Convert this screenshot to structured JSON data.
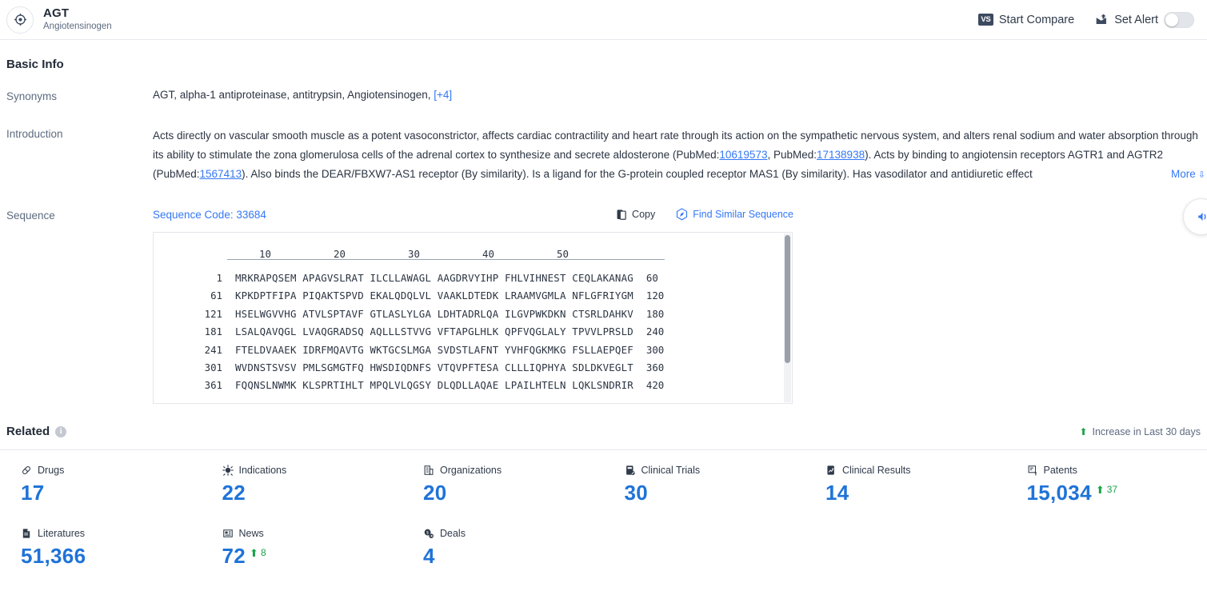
{
  "header": {
    "logo_icon": "target-crosshair-icon",
    "title": "AGT",
    "subtitle": "Angiotensinogen",
    "compare_badge": "VS",
    "compare_label": "Start Compare",
    "alert_icon": "alert-envelope-icon",
    "alert_label": "Set Alert",
    "alert_toggle_state": "off"
  },
  "basic_info": {
    "section_title": "Basic Info",
    "synonyms": {
      "label": "Synonyms",
      "value": "AGT,  alpha-1 antiproteinase, antitrypsin,  Angiotensinogen,",
      "more_count": "[+4]"
    },
    "introduction": {
      "label": "Introduction",
      "part1": "Acts directly on vascular smooth muscle as a potent vasoconstrictor, affects cardiac contractility and heart rate through its action on the sympathetic nervous system, and alters renal sodium and water absorption through its ability to stimulate the zona glomerulosa cells of the adrenal cortex to synthesize and secrete aldosterone (PubMed:",
      "pubmed1": "10619573",
      "part2": ", PubMed:",
      "pubmed2": "17138938",
      "part3": "). Acts by binding to angiotensin receptors AGTR1 and AGTR2 (PubMed:",
      "pubmed3": "1567413",
      "part4": "). Also binds the DEAR/FBXW7-AS1 receptor (By similarity). Is a ligand for the G-protein coupled receptor MAS1 (By similarity). Has vasodilator and antidiuretic effect",
      "more_label": "More",
      "more_chevron": "chevron-double-down-icon"
    },
    "sequence": {
      "label": "Sequence",
      "code_label": "Sequence Code: 33684",
      "copy_icon": "copy-icon",
      "copy_label": "Copy",
      "find_similar_icon": "hexagon-compass-icon",
      "find_similar_label": "Find Similar Sequence",
      "ruler_ticks": [
        "10",
        "20",
        "30",
        "40",
        "50"
      ],
      "lines": [
        {
          "start": "1",
          "chunks": "MRKRAPQSEM APAGVSLRAT ILCLLAWAGL AAGDRVYIHP FHLVIHNEST CEQLAKANAG",
          "end": "60"
        },
        {
          "start": "61",
          "chunks": "KPKDPTFIPA PIQAKTSPVD EKALQDQLVL VAAKLDTEDK LRAAMVGMLA NFLGFRIYGM",
          "end": "120"
        },
        {
          "start": "121",
          "chunks": "HSELWGVVHG ATVLSPTAVF GTLASLYLGA LDHTADRLQA ILGVPWKDKN CTSRLDAHKV",
          "end": "180"
        },
        {
          "start": "181",
          "chunks": "LSALQAVQGL LVAQGRADSQ AQLLLSTVVG VFTAPGLHLK QPFVQGLALY TPVVLPRSLD",
          "end": "240"
        },
        {
          "start": "241",
          "chunks": "FTELDVAAEK IDRFMQAVTG WKTGCSLMGA SVDSTLAFNT YVHFQGKMKG FSLLAEPQEF",
          "end": "300"
        },
        {
          "start": "301",
          "chunks": "WVDNSTSVSV PMLSGMGTFQ HWSDIQDNFS VTQVPFTESA CLLLIQPHYA SDLDKVEGLT",
          "end": "360"
        },
        {
          "start": "361",
          "chunks": "FQQNSLNWMK KLSPRTIHLT MPQLVLQGSY DLQDLLAQAE LPAILHTELN LQKLSNDRIR",
          "end": "420"
        }
      ]
    }
  },
  "related": {
    "title": "Related",
    "info_icon": "info-icon",
    "info_glyph": "i",
    "increase_arrow": "arrow-up-icon",
    "increase_label": "Increase in Last 30 days",
    "cards": [
      {
        "icon": "pill-icon",
        "label": "Drugs",
        "value": "17"
      },
      {
        "icon": "virus-icon",
        "label": "Indications",
        "value": "22"
      },
      {
        "icon": "building-icon",
        "label": "Organizations",
        "value": "20"
      },
      {
        "icon": "clinical-trial-icon",
        "label": "Clinical Trials",
        "value": "30"
      },
      {
        "icon": "clinical-result-icon",
        "label": "Clinical Results",
        "value": "14"
      },
      {
        "icon": "patent-icon",
        "label": "Patents",
        "value": "15,034",
        "delta": "37"
      },
      {
        "icon": "literature-icon",
        "label": "Literatures",
        "value": "51,366"
      },
      {
        "icon": "news-icon",
        "label": "News",
        "value": "72",
        "delta": "8"
      },
      {
        "icon": "deals-icon",
        "label": "Deals",
        "value": "4"
      }
    ]
  },
  "colors": {
    "accent_blue": "#3478f6",
    "value_blue": "#1f73d8",
    "green": "#1aa34a",
    "dark_navy": "#3c4a60"
  }
}
